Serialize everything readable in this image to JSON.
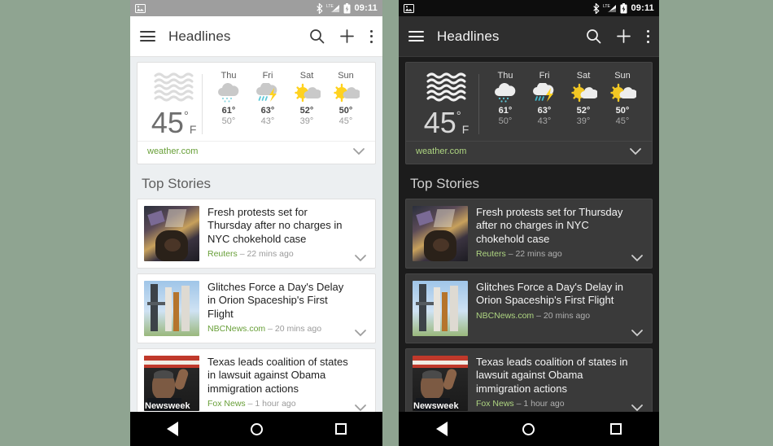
{
  "background_color": "#8fa491",
  "themes": {
    "light": {
      "name": "light",
      "accent_green": "#689f38",
      "card_bg": "#ffffff",
      "page_bg": "#eceff1",
      "statusbar_bg": "#9e9e9e"
    },
    "dark": {
      "name": "dark",
      "accent_green": "#aed581",
      "card_bg": "#3a3a3a",
      "page_bg": "#1c1c1c",
      "statusbar_bg": "#0d0d0d"
    }
  },
  "status_bar": {
    "screenshot_icon": "image-icon",
    "bluetooth_icon": "bluetooth-icon",
    "network_label": "LTE",
    "signal_icon": "signal-icon",
    "battery_icon": "battery-charging-icon",
    "time": "09:11"
  },
  "app_bar": {
    "menu_icon": "hamburger-menu-icon",
    "title": "Headlines",
    "search_icon": "search-icon",
    "add_icon": "plus-icon",
    "overflow_icon": "overflow-menu-icon"
  },
  "weather": {
    "current_icon": "fog-icon",
    "current_temp": "45",
    "degree_symbol": "°",
    "unit": "F",
    "source": "weather.com",
    "expand_icon": "chevron-down-icon",
    "forecast": [
      {
        "day": "Thu",
        "icon": "rain-snow-cloud-icon",
        "high": "61°",
        "low": "50°"
      },
      {
        "day": "Fri",
        "icon": "thunderstorm-icon",
        "high": "63°",
        "low": "43°"
      },
      {
        "day": "Sat",
        "icon": "sun-behind-cloud-icon",
        "high": "52°",
        "low": "39°"
      },
      {
        "day": "Sun",
        "icon": "sun-behind-cloud-icon",
        "high": "50°",
        "low": "45°"
      }
    ]
  },
  "section": {
    "title": "Top Stories"
  },
  "stories": [
    {
      "headline": "Fresh protests set for Thursday after no charges in NYC chokehold case",
      "publisher": "Reuters",
      "separator": "–",
      "time": "22 mins ago",
      "thumb_name": "protest-photo",
      "watermark": "",
      "expand_icon": "chevron-down-icon"
    },
    {
      "headline": "Glitches Force a Day's Delay in Orion Spaceship's First Flight",
      "publisher": "NBCNews.com",
      "separator": "–",
      "time": "20 mins ago",
      "thumb_name": "rocket-launchpad-photo",
      "watermark": "",
      "expand_icon": "chevron-down-icon"
    },
    {
      "headline": "Texas leads coalition of states in lawsuit against Obama immigration actions",
      "publisher": "Fox News",
      "separator": "–",
      "time": "1 hour ago",
      "thumb_name": "obama-photo",
      "watermark": "Newsweek",
      "expand_icon": "chevron-down-icon"
    }
  ],
  "nav_bar": {
    "back_icon": "back-triangle-icon",
    "home_icon": "home-circle-icon",
    "recents_icon": "recents-square-icon"
  }
}
